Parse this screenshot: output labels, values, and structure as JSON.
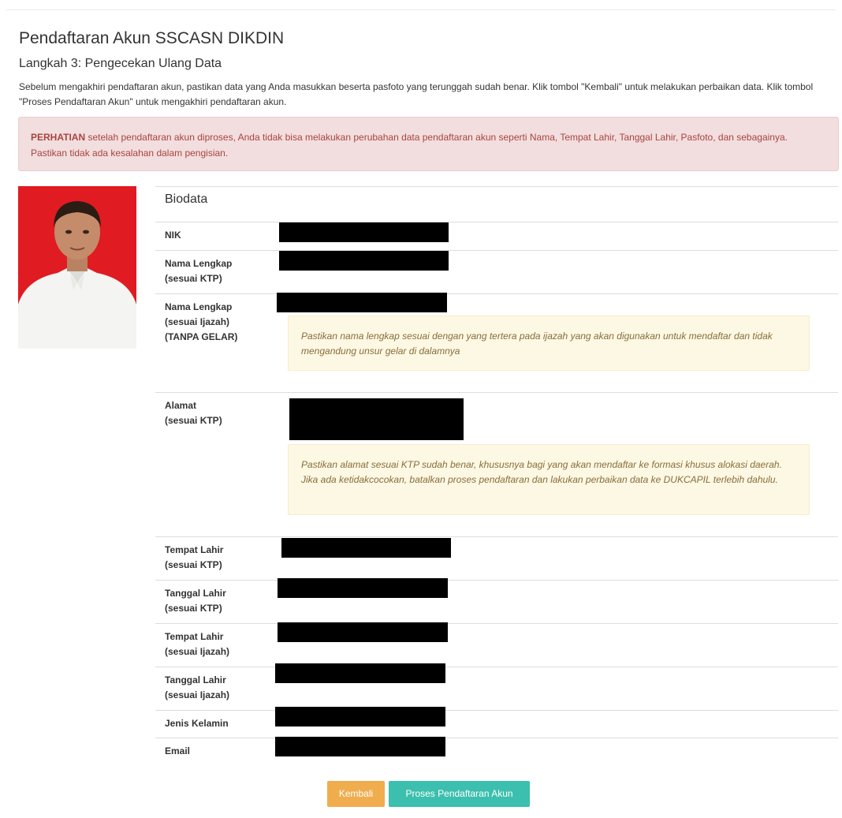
{
  "page": {
    "title": "Pendaftaran Akun SSCASN DIKDIN",
    "step_title": "Langkah 3: Pengecekan Ulang Data",
    "intro": "Sebelum mengakhiri pendaftaran akun, pastikan data yang Anda masukkan beserta pasfoto yang terunggah sudah benar. Klik tombol \"Kembali\" untuk melakukan perbaikan data. Klik tombol \"Proses Pendaftaran Akun\" untuk mengakhiri pendaftaran akun."
  },
  "alert": {
    "strong": "PERHATIAN",
    "text": " setelah pendaftaran akun diproses, Anda tidak bisa melakukan perubahan data pendaftaran akun seperti Nama, Tempat Lahir, Tanggal Lahir, Pasfoto, dan sebagainya. Pastikan tidak ada kesalahan dalam pengisian."
  },
  "biodata": {
    "heading": "Biodata",
    "fields": [
      {
        "label_1": "NIK",
        "label_2": "",
        "label_3": "",
        "value": ""
      },
      {
        "label_1": "Nama Lengkap",
        "label_2": "(sesuai KTP)",
        "label_3": "",
        "value": ""
      },
      {
        "label_1": "Nama Lengkap",
        "label_2": "(sesuai Ijazah)",
        "label_3": "(TANPA GELAR)",
        "value": ""
      },
      {
        "label_1": "Alamat",
        "label_2": "(sesuai KTP)",
        "label_3": "",
        "value": ""
      },
      {
        "label_1": "Tempat Lahir",
        "label_2": "(sesuai KTP)",
        "label_3": "",
        "value": ""
      },
      {
        "label_1": "Tanggal Lahir",
        "label_2": "(sesuai KTP)",
        "label_3": "",
        "value": ""
      },
      {
        "label_1": "Tempat Lahir",
        "label_2": "(sesuai Ijazah)",
        "label_3": "",
        "value": ""
      },
      {
        "label_1": "Tanggal Lahir",
        "label_2": "(sesuai Ijazah)",
        "label_3": "",
        "value": ""
      },
      {
        "label_1": "Jenis Kelamin",
        "label_2": "",
        "label_3": "",
        "value": ""
      },
      {
        "label_1": "Email",
        "label_2": "",
        "label_3": "",
        "value": ""
      }
    ],
    "name_note": "Pastikan nama lengkap sesuai dengan yang tertera pada ijazah yang akan digunakan untuk mendaftar dan tidak mengandung unsur gelar di dalamnya",
    "address_note": "Pastikan alamat sesuai KTP sudah benar, khususnya bagi yang akan mendaftar ke formasi khusus alokasi daerah. Jika ada ketidakcocokan, batalkan proses pendaftaran dan lakukan perbaikan data ke DUKCAPIL terlebih dahulu."
  },
  "buttons": {
    "back": "Kembali",
    "submit": "Proses Pendaftaran Akun"
  },
  "colors": {
    "danger_bg": "#f2dede",
    "danger_text": "#a94442",
    "warning_bg": "#fcf8e3",
    "warning_text": "#8a6d3b",
    "back_button": "#f0ad4e",
    "submit_button": "#3cbfae",
    "photo_background": "#e01b22"
  }
}
